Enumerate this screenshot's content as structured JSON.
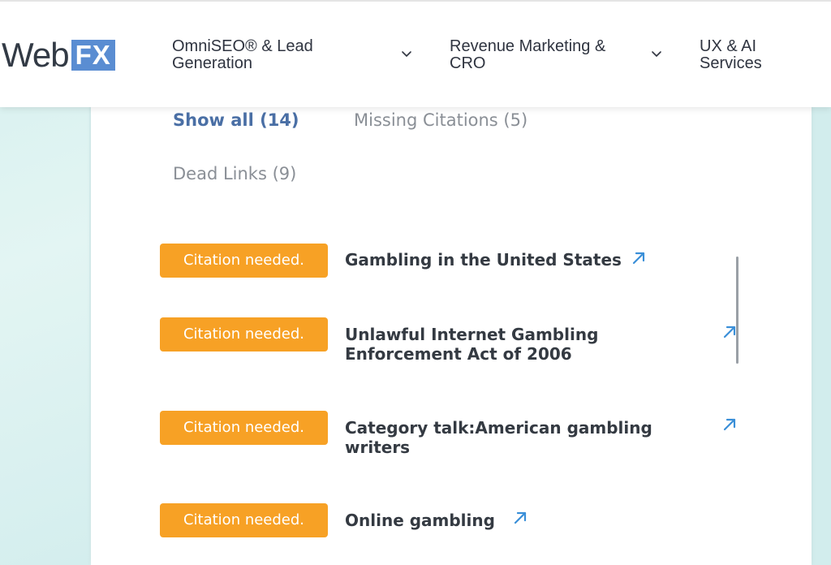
{
  "header": {
    "logo_web": "Web",
    "logo_fx": "FX",
    "nav": [
      {
        "label_line1": "OmniSEO® & Lead",
        "label_line2": "Generation"
      },
      {
        "label_line1": "Revenue Marketing &",
        "label_line2": "CRO"
      },
      {
        "label_line1": "UX & AI",
        "label_line2": "Services"
      }
    ]
  },
  "filters": {
    "show_all": "Show all (14)",
    "missing_citations": "Missing Citations (5)",
    "dead_links": "Dead Links (9)"
  },
  "results": [
    {
      "badge": "Citation needed.",
      "title_line1": "Gambling in the United States",
      "title_line2": ""
    },
    {
      "badge": "Citation needed.",
      "title_line1": "Unlawful Internet Gambling",
      "title_line2": "Enforcement Act of 2006"
    },
    {
      "badge": "Citation needed.",
      "title_line1": "Category talk:American gambling",
      "title_line2": "writers"
    },
    {
      "badge": "Citation needed.",
      "title_line1": "Online gambling",
      "title_line2": ""
    }
  ],
  "colors": {
    "badge": "#f7a125",
    "link_icon": "#3a8fd8",
    "logo_fx_bg": "#5a8dd2",
    "active_filter": "#4a6fa5"
  },
  "icons": {
    "nav_chevron": "chevron-down-icon",
    "external_link": "external-link-icon"
  }
}
